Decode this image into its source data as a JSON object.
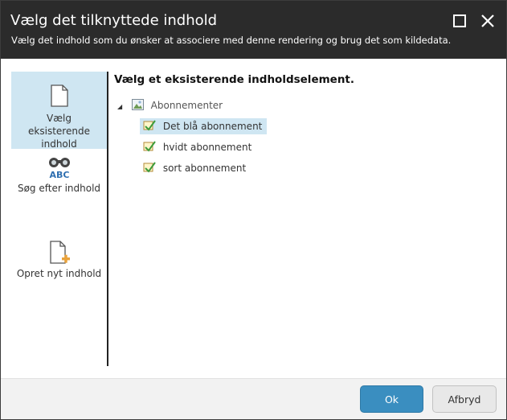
{
  "dialog": {
    "title": "Vælg det tilknyttede indhold",
    "subtitle": "Vælg det indhold som du ønsker at associere med denne rendering og brug det som kildedata.",
    "maximize_icon": "maximize-icon",
    "close_icon": "close-icon"
  },
  "sidebar": {
    "items": [
      {
        "label": "Vælg eksisterende indhold",
        "icon": "document-icon",
        "active": true
      },
      {
        "label": "Søg efter indhold",
        "icon": "binoculars-abc-icon",
        "active": false
      },
      {
        "label": "Opret nyt indhold",
        "icon": "new-document-icon",
        "active": false
      }
    ]
  },
  "main": {
    "heading": "Vælg et eksisterende indholdselement.",
    "tree": {
      "root": {
        "label": "Abonnementer",
        "expanded": true,
        "icon": "folder-image-icon"
      },
      "children": [
        {
          "label": "Det blå abonnement",
          "selected": true,
          "icon": "item-icon"
        },
        {
          "label": "hvidt abonnement",
          "selected": false,
          "icon": "item-icon"
        },
        {
          "label": "sort abonnement",
          "selected": false,
          "icon": "item-icon"
        }
      ]
    }
  },
  "footer": {
    "ok_label": "Ok",
    "cancel_label": "Afbryd"
  },
  "colors": {
    "header_bg": "#2b2b2b",
    "selection_bg": "#cfe6f2",
    "primary_button": "#3a8ec0"
  }
}
